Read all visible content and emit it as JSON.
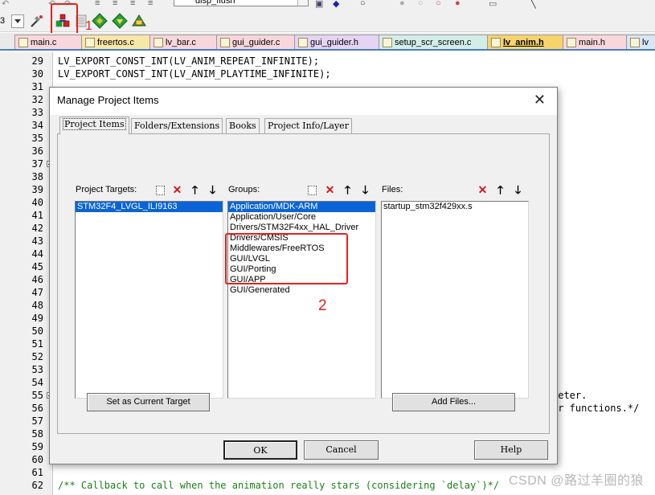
{
  "toolbar_top": {
    "dropdown_value": "disp_flush"
  },
  "toolbar": {
    "target_number": "3",
    "manage_project_icon": "manage-project-items-icon",
    "annotation_number": "1"
  },
  "file_tabs": [
    {
      "label": "main.c",
      "color": "#f8d7dc"
    },
    {
      "label": "freertos.c",
      "color": "#f7e7a8"
    },
    {
      "label": "lv_bar.c",
      "color": "#f8d7dc"
    },
    {
      "label": "gui_guider.c",
      "color": "#f8d7dc"
    },
    {
      "label": "gui_guider.h",
      "color": "#e5d4f2"
    },
    {
      "label": "setup_scr_screen.c",
      "color": "#d3eee8"
    },
    {
      "label": "lv_anim.h",
      "color": "#f7d36b"
    },
    {
      "label": "main.h",
      "color": "#f8d7dc"
    },
    {
      "label": "lv",
      "color": "#d8e6f4"
    }
  ],
  "editor": {
    "line_numbers": [
      "29",
      "30",
      "31",
      "32",
      "33",
      "34",
      "35",
      "36",
      "37",
      "38",
      "39",
      "40",
      "41",
      "42",
      "43",
      "44",
      "45",
      "46",
      "47",
      "48",
      "49",
      "50",
      "51",
      "52",
      "53",
      "54",
      "55",
      "56",
      "57",
      "58",
      "59",
      "60",
      "61",
      "62"
    ],
    "line29": "LV_EXPORT_CONST_INT(LV_ANIM_REPEAT_INFINITE);",
    "line30": "LV_EXPORT_CONST_INT(LV_ANIM_PLAYTIME_INFINITE);",
    "line55_tail": "meter.",
    "line56_tail": "or functions.*/",
    "line62": "/** Callback to call when the animation really stars (considering `delay`)*/"
  },
  "watermark": "CSDN @路过羊圈的狼",
  "dialog": {
    "title": "Manage Project Items",
    "tabs": [
      "Project Items",
      "Folders/Extensions",
      "Books",
      "Project Info/Layer"
    ],
    "targets": {
      "label": "Project Targets:",
      "items": [
        "STM32F4_LVGL_ILI9163"
      ]
    },
    "groups": {
      "label": "Groups:",
      "items": [
        "Application/MDK-ARM",
        "Application/User/Core",
        "Drivers/STM32F4xx_HAL_Driver",
        "Drivers/CMSIS",
        "Middlewares/FreeRTOS",
        "GUI/LVGL",
        "GUI/Porting",
        "GUI/APP",
        "GUI/Generated"
      ]
    },
    "files": {
      "label": "Files:",
      "items": [
        "startup_stm32f429xx.s"
      ]
    },
    "set_current_target": "Set as Current Target",
    "add_files": "Add Files...",
    "ok": "OK",
    "cancel": "Cancel",
    "help": "Help",
    "annotation_number": "2"
  }
}
